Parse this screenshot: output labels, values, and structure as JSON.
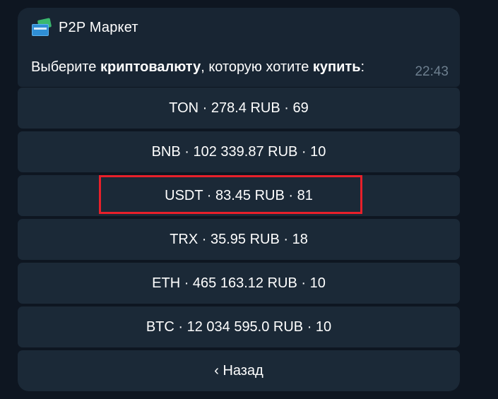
{
  "message": {
    "bot_name": "P2P Маркет",
    "icon": "credit-cards-icon",
    "text_parts": [
      "Выберите ",
      "криптовалюту",
      ", которую хотите ",
      "купить",
      ":"
    ],
    "time": "22:43"
  },
  "keyboard": {
    "buttons": [
      "TON · 278.4 RUB · 69",
      "BNB · 102 339.87 RUB · 10",
      "USDT · 83.45 RUB · 81",
      "TRX · 35.95 RUB · 18",
      "ETH · 465 163.12 RUB · 10",
      "BTC · 12 034 595.0 RUB · 10",
      "‹ Назад"
    ]
  },
  "colors": {
    "background": "#0e1621",
    "bubble": "#182533",
    "button": "#1b2937",
    "highlight": "#e8202a",
    "time": "#6d7f8f"
  }
}
